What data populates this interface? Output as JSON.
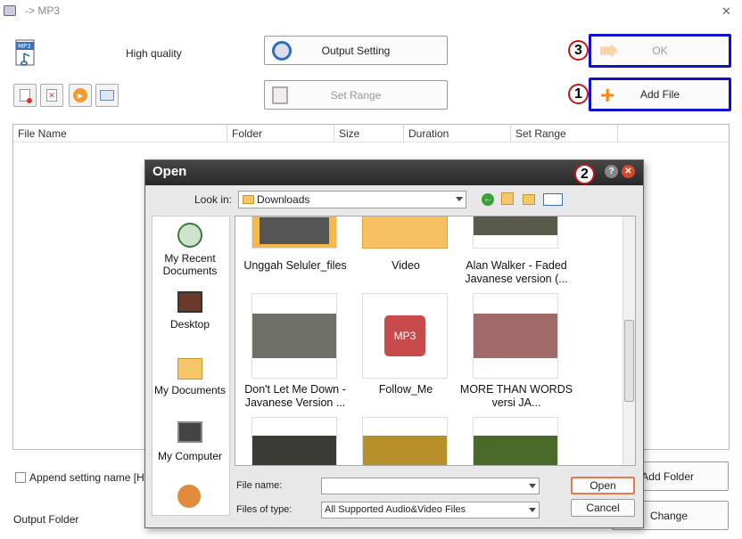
{
  "window": {
    "title": "-> MP3"
  },
  "header": {
    "quality": "High quality",
    "output_setting": "Output Setting",
    "set_range": "Set Range",
    "ok": "OK",
    "add_file": "Add File"
  },
  "annotations": {
    "one": "1",
    "two": "2",
    "three": "3"
  },
  "table": {
    "columns": [
      "File Name",
      "Folder",
      "Size",
      "Duration",
      "Set Range"
    ]
  },
  "bottom": {
    "append_label": "Append setting name [High",
    "output_folder": "Output Folder",
    "add_folder": "Add Folder",
    "change": "Change"
  },
  "dialog": {
    "title": "Open",
    "look_in_label": "Look in:",
    "look_in_value": "Downloads",
    "places": [
      "My Recent Documents",
      "Desktop",
      "My Documents",
      "My Computer"
    ],
    "files": [
      {
        "name": "Unggah Seluler_files"
      },
      {
        "name": "Video"
      },
      {
        "name": "Alan Walker - Faded Javanese version (..."
      },
      {
        "name": "Don't Let Me Down - Javanese Version ..."
      },
      {
        "name": "Follow_Me",
        "badge": "MP3"
      },
      {
        "name": "MORE THAN WORDS versi JA..."
      }
    ],
    "filename_label": "File name:",
    "filename_value": "",
    "filetype_label": "Files of type:",
    "filetype_value": "All Supported Audio&Video Files",
    "open": "Open",
    "cancel": "Cancel"
  },
  "colors": {
    "highlight": "#1010c8",
    "annotation": "#c01818",
    "folder": "#f5b84a",
    "title_bar": "#333333"
  }
}
